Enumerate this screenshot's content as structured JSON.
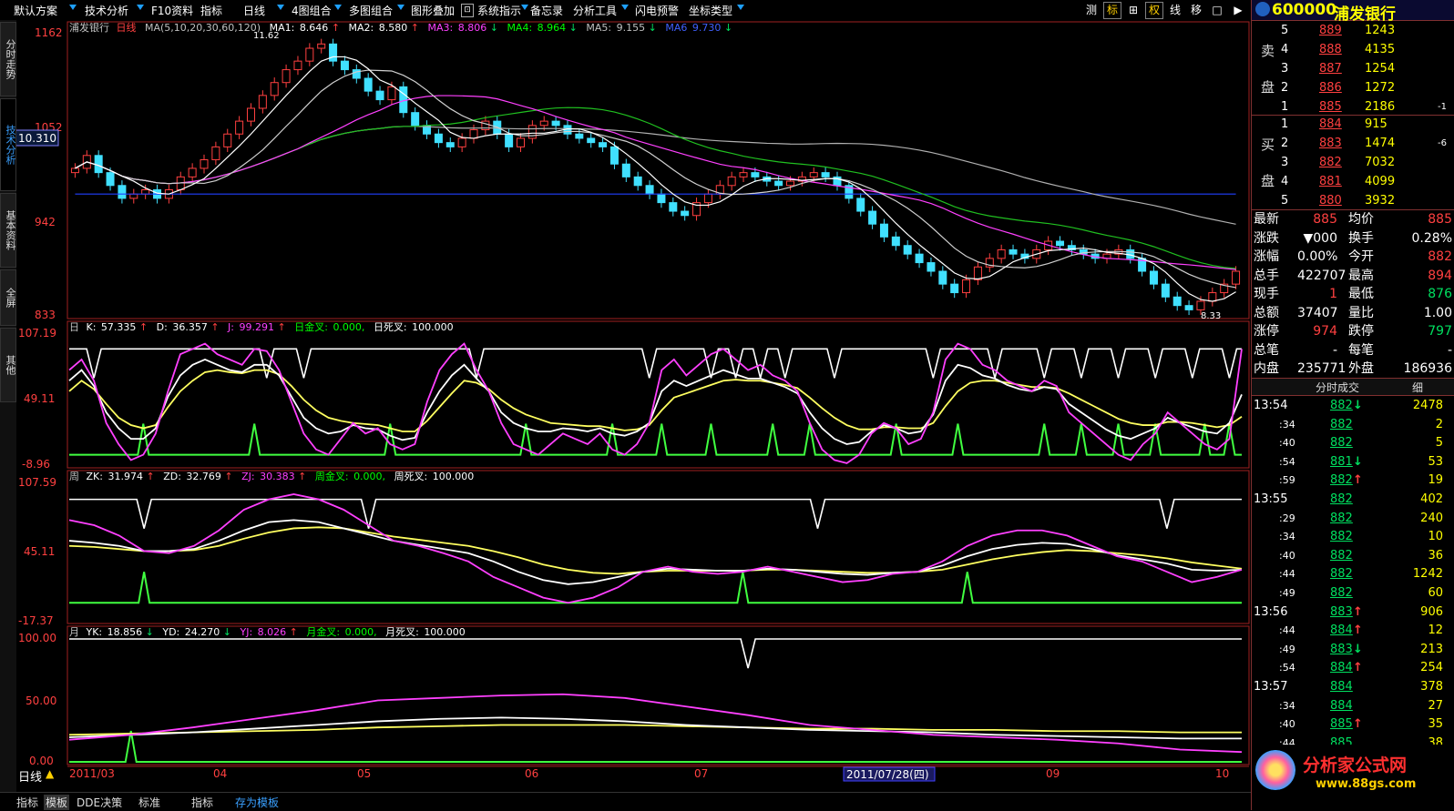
{
  "toolbar": {
    "menus": [
      "默认方案",
      "技术分析",
      "F10资料",
      "指标",
      "日线",
      "4图组合",
      "多图组合",
      "图形叠加",
      "系统指示",
      "备忘录",
      "分析工具",
      "闪电预警",
      "坐标类型"
    ],
    "right_buttons": [
      "测",
      "标",
      "⊞",
      "权",
      "线",
      "移",
      "□",
      "▶"
    ]
  },
  "side_tabs": [
    "分时走势",
    "技术分析",
    "基本资料",
    "全屏",
    "其他"
  ],
  "stock": {
    "code": "600000",
    "name": "浦发银行"
  },
  "main": {
    "title": "浦发银行",
    "period": "日线",
    "ma_header": "MA(5,10,20,30,60,120)",
    "ma": [
      {
        "label": "MA1:",
        "value": "8.646",
        "arrow": "↑",
        "color": "#ffffff"
      },
      {
        "label": "MA2:",
        "value": "8.580",
        "arrow": "↑",
        "color": "#ffffff"
      },
      {
        "label": "MA3:",
        "value": "8.806",
        "arrow": "↓",
        "color": "#ff40ff"
      },
      {
        "label": "MA4:",
        "value": "8.964",
        "arrow": "↓",
        "color": "#00ff00"
      },
      {
        "label": "MA5:",
        "value": "9.155",
        "arrow": "↓",
        "color": "#c0c0c0"
      },
      {
        "label": "MA6",
        "value": "9.730",
        "arrow": "↓",
        "color": "#4060ff"
      }
    ],
    "y_labels": [
      "1162",
      "1052",
      "942",
      "833"
    ],
    "current_price_tag": "10.310",
    "high_label": "11.62",
    "low_label": "8.33",
    "ylim": [
      8.33,
      11.62
    ]
  },
  "kdj": {
    "prefix": "日",
    "items": [
      {
        "label": "K:",
        "value": "57.335",
        "arrow": "↑",
        "color": "#ffffff"
      },
      {
        "label": "D:",
        "value": "36.357",
        "arrow": "↑",
        "color": "#ffffff"
      },
      {
        "label": "J:",
        "value": "99.291",
        "arrow": "↑",
        "color": "#ff40ff"
      },
      {
        "label": "日金叉:",
        "value": "0.000,",
        "arrow": "",
        "color": "#00ff00"
      },
      {
        "label": "日死叉:",
        "value": "100.000",
        "arrow": "",
        "color": "#ffffff"
      }
    ],
    "y_labels": [
      "107.19",
      "49.11",
      "-8.96"
    ]
  },
  "weekly": {
    "prefix": "周",
    "items": [
      {
        "label": "ZK:",
        "value": "31.974",
        "arrow": "↑",
        "color": "#ffffff"
      },
      {
        "label": "ZD:",
        "value": "32.769",
        "arrow": "↑",
        "color": "#ffffff"
      },
      {
        "label": "ZJ:",
        "value": "30.383",
        "arrow": "↑",
        "color": "#ff40ff"
      },
      {
        "label": "周金叉:",
        "value": "0.000,",
        "arrow": "",
        "color": "#00ff00"
      },
      {
        "label": "周死叉:",
        "value": "100.000",
        "arrow": "",
        "color": "#ffffff"
      }
    ],
    "y_labels": [
      "107.59",
      "45.11",
      "-17.37"
    ]
  },
  "monthly": {
    "prefix": "月",
    "items": [
      {
        "label": "YK:",
        "value": "18.856",
        "arrow": "↓",
        "color": "#ffffff"
      },
      {
        "label": "YD:",
        "value": "24.270",
        "arrow": "↓",
        "color": "#ffffff"
      },
      {
        "label": "YJ:",
        "value": "8.026",
        "arrow": "↑",
        "color": "#ff40ff"
      },
      {
        "label": "月金叉:",
        "value": "0.000,",
        "arrow": "",
        "color": "#00ff00"
      },
      {
        "label": "月死叉:",
        "value": "100.000",
        "arrow": "",
        "color": "#ffffff"
      }
    ],
    "y_labels": [
      "100.00",
      "50.00",
      "0.00"
    ]
  },
  "x_axis": {
    "labels": [
      "2011/03",
      "04",
      "05",
      "06",
      "07",
      "09",
      "10"
    ],
    "cursor_date": "2011/07/28(四)"
  },
  "bottom": {
    "period_label": "日线",
    "tabs": [
      "指标",
      "模板",
      "DDE决策",
      "标准",
      "指标",
      "存为模板"
    ]
  },
  "order_book": {
    "sell_label": [
      "卖",
      "盘"
    ],
    "buy_label": [
      "买",
      "盘"
    ],
    "sell": [
      {
        "level": "5",
        "price": "889",
        "vol": "1243",
        "chg": ""
      },
      {
        "level": "4",
        "price": "888",
        "vol": "4135",
        "chg": ""
      },
      {
        "level": "3",
        "price": "887",
        "vol": "1254",
        "chg": ""
      },
      {
        "level": "2",
        "price": "886",
        "vol": "1272",
        "chg": ""
      },
      {
        "level": "1",
        "price": "885",
        "vol": "2186",
        "chg": "-1"
      }
    ],
    "buy": [
      {
        "level": "1",
        "price": "884",
        "vol": "915",
        "chg": ""
      },
      {
        "level": "2",
        "price": "883",
        "vol": "1474",
        "chg": "-6"
      },
      {
        "level": "3",
        "price": "882",
        "vol": "7032",
        "chg": ""
      },
      {
        "level": "4",
        "price": "881",
        "vol": "4099",
        "chg": ""
      },
      {
        "level": "5",
        "price": "880",
        "vol": "3932",
        "chg": ""
      }
    ]
  },
  "stats": [
    {
      "l1": "最新",
      "v1": "885",
      "c1": "red",
      "l2": "均价",
      "v2": "885",
      "c2": "red"
    },
    {
      "l1": "涨跌",
      "v1": "▼000",
      "c1": "white",
      "l2": "换手",
      "v2": "0.28%",
      "c2": "white"
    },
    {
      "l1": "涨幅",
      "v1": "0.00%",
      "c1": "white",
      "l2": "今开",
      "v2": "882",
      "c2": "red"
    },
    {
      "l1": "总手",
      "v1": "422707",
      "c1": "white",
      "l2": "最高",
      "v2": "894",
      "c2": "red"
    },
    {
      "l1": "现手",
      "v1": "1",
      "c1": "red",
      "l2": "最低",
      "v2": "876",
      "c2": "green"
    },
    {
      "l1": "总额",
      "v1": "37407",
      "c1": "white",
      "l2": "量比",
      "v2": "1.00",
      "c2": "white"
    },
    {
      "l1": "涨停",
      "v1": "974",
      "c1": "red",
      "l2": "跌停",
      "v2": "797",
      "c2": "green"
    },
    {
      "l1": "总笔",
      "v1": "-",
      "c1": "white",
      "l2": "每笔",
      "v2": "-",
      "c2": "white"
    },
    {
      "l1": "内盘",
      "v1": "235771",
      "c1": "white",
      "l2": "外盘",
      "v2": "186936",
      "c2": "white"
    }
  ],
  "ticks": {
    "header": "分时成交",
    "detail": "细",
    "rows": [
      {
        "t": "13:54",
        "p": "882",
        "a": "↓",
        "ac": "green",
        "v": "2478"
      },
      {
        "t": ":34",
        "p": "882",
        "a": "",
        "ac": "",
        "v": "2"
      },
      {
        "t": ":40",
        "p": "882",
        "a": "",
        "ac": "",
        "v": "5"
      },
      {
        "t": ":54",
        "p": "881",
        "a": "↓",
        "ac": "green",
        "v": "53"
      },
      {
        "t": ":59",
        "p": "882",
        "a": "↑",
        "ac": "red",
        "v": "19"
      },
      {
        "t": "13:55",
        "p": "882",
        "a": "",
        "ac": "",
        "v": "402"
      },
      {
        "t": ":29",
        "p": "882",
        "a": "",
        "ac": "",
        "v": "240"
      },
      {
        "t": ":34",
        "p": "882",
        "a": "",
        "ac": "",
        "v": "10"
      },
      {
        "t": ":40",
        "p": "882",
        "a": "",
        "ac": "",
        "v": "36"
      },
      {
        "t": ":44",
        "p": "882",
        "a": "",
        "ac": "",
        "v": "1242"
      },
      {
        "t": ":49",
        "p": "882",
        "a": "",
        "ac": "",
        "v": "60"
      },
      {
        "t": "13:56",
        "p": "883",
        "a": "↑",
        "ac": "red",
        "v": "906"
      },
      {
        "t": ":44",
        "p": "884",
        "a": "↑",
        "ac": "red",
        "v": "12"
      },
      {
        "t": ":49",
        "p": "883",
        "a": "↓",
        "ac": "green",
        "v": "213"
      },
      {
        "t": ":54",
        "p": "884",
        "a": "↑",
        "ac": "red",
        "v": "254"
      },
      {
        "t": "13:57",
        "p": "884",
        "a": "",
        "ac": "",
        "v": "378"
      },
      {
        "t": ":34",
        "p": "884",
        "a": "",
        "ac": "",
        "v": "27"
      },
      {
        "t": ":40",
        "p": "885",
        "a": "↑",
        "ac": "red",
        "v": "35"
      },
      {
        "t": ":44",
        "p": "885",
        "a": "",
        "ac": "",
        "v": "38"
      }
    ]
  },
  "watermark": {
    "text": "分析家公式网",
    "url": "www.88gs.com"
  },
  "colors": {
    "up": "#ff4040",
    "down": "#40e0ff",
    "ma_white": "#ffffff",
    "ma_magenta": "#ff40ff",
    "ma_green": "#20c020",
    "ma_gray": "#b0b0b0",
    "ma_blue": "#2040ff",
    "yellow": "#ffff60",
    "gold_cross": "#40ff40"
  },
  "chart_data": {
    "type": "candlestick",
    "ylim": [
      8.33,
      11.62
    ],
    "close_series": [
      10.05,
      10.2,
      10.0,
      9.85,
      9.7,
      9.75,
      9.8,
      9.7,
      9.8,
      9.95,
      10.05,
      10.15,
      10.3,
      10.45,
      10.6,
      10.75,
      10.9,
      11.05,
      11.2,
      11.3,
      11.45,
      11.5,
      11.3,
      11.2,
      11.1,
      10.95,
      10.85,
      11.0,
      10.7,
      10.55,
      10.45,
      10.35,
      10.3,
      10.4,
      10.5,
      10.6,
      10.45,
      10.3,
      10.4,
      10.55,
      10.6,
      10.55,
      10.45,
      10.4,
      10.35,
      10.3,
      10.1,
      9.95,
      9.85,
      9.75,
      9.65,
      9.55,
      9.5,
      9.65,
      9.75,
      9.85,
      9.95,
      10.0,
      9.95,
      9.9,
      9.85,
      9.9,
      9.95,
      10.0,
      9.95,
      9.85,
      9.7,
      9.55,
      9.4,
      9.25,
      9.15,
      9.05,
      8.95,
      8.85,
      8.7,
      8.6,
      8.75,
      8.9,
      9.0,
      9.1,
      9.05,
      9.0,
      9.1,
      9.2,
      9.15,
      9.1,
      9.05,
      9.0,
      9.05,
      9.1,
      9.0,
      8.85,
      8.7,
      8.55,
      8.45,
      8.4,
      8.5,
      8.6,
      8.7,
      8.85
    ],
    "kdj": {
      "J": [
        80,
        90,
        70,
        30,
        10,
        -5,
        0,
        20,
        60,
        95,
        100,
        105,
        95,
        90,
        85,
        100,
        98,
        80,
        50,
        20,
        5,
        0,
        15,
        30,
        20,
        25,
        10,
        5,
        10,
        50,
        80,
        95,
        105,
        80,
        60,
        30,
        10,
        5,
        0,
        10,
        20,
        15,
        10,
        20,
        5,
        0,
        10,
        30,
        80,
        90,
        75,
        85,
        95,
        100,
        90,
        80,
        85,
        75,
        70,
        60,
        30,
        5,
        -5,
        -8,
        0,
        20,
        30,
        25,
        10,
        15,
        40,
        90,
        105,
        100,
        85,
        80,
        70,
        65,
        60,
        70,
        65,
        40,
        30,
        20,
        10,
        0,
        -5,
        10,
        20,
        40,
        30,
        20,
        10,
        5,
        15,
        100
      ],
      "K": [
        70,
        80,
        65,
        40,
        25,
        15,
        15,
        25,
        55,
        75,
        85,
        90,
        85,
        80,
        78,
        85,
        85,
        75,
        55,
        35,
        25,
        20,
        22,
        28,
        25,
        24,
        18,
        14,
        16,
        40,
        60,
        75,
        85,
        72,
        60,
        40,
        30,
        25,
        22,
        22,
        25,
        24,
        22,
        25,
        20,
        18,
        22,
        30,
        60,
        70,
        65,
        70,
        75,
        80,
        76,
        72,
        72,
        68,
        64,
        58,
        40,
        25,
        15,
        10,
        12,
        22,
        28,
        25,
        20,
        22,
        38,
        70,
        85,
        82,
        75,
        72,
        66,
        62,
        60,
        64,
        62,
        48,
        40,
        32,
        24,
        18,
        15,
        20,
        25,
        35,
        30,
        26,
        22,
        20,
        30,
        57
      ],
      "D": [
        60,
        70,
        62,
        48,
        35,
        28,
        25,
        28,
        45,
        60,
        70,
        78,
        80,
        78,
        77,
        80,
        80,
        76,
        65,
        52,
        42,
        35,
        32,
        30,
        29,
        28,
        25,
        22,
        22,
        32,
        45,
        58,
        70,
        68,
        62,
        52,
        44,
        38,
        34,
        30,
        29,
        28,
        27,
        27,
        25,
        23,
        24,
        28,
        42,
        54,
        58,
        62,
        66,
        70,
        71,
        70,
        70,
        68,
        66,
        63,
        54,
        44,
        35,
        28,
        24,
        24,
        26,
        26,
        25,
        25,
        30,
        46,
        60,
        68,
        70,
        70,
        68,
        66,
        64,
        64,
        63,
        58,
        52,
        46,
        40,
        34,
        30,
        28,
        28,
        31,
        31,
        30,
        28,
        26,
        28,
        36
      ]
    },
    "weekly": {
      "ZJ": [
        80,
        75,
        65,
        50,
        48,
        55,
        70,
        90,
        100,
        105,
        100,
        90,
        75,
        60,
        55,
        48,
        40,
        25,
        15,
        5,
        0,
        5,
        15,
        30,
        35,
        30,
        28,
        30,
        35,
        30,
        25,
        20,
        22,
        28,
        30,
        40,
        55,
        65,
        70,
        70,
        65,
        55,
        45,
        40,
        30,
        20,
        25,
        32
      ],
      "ZK": [
        60,
        58,
        55,
        50,
        50,
        52,
        60,
        70,
        78,
        80,
        78,
        72,
        66,
        60,
        56,
        52,
        48,
        40,
        30,
        22,
        18,
        20,
        25,
        30,
        33,
        32,
        31,
        31,
        33,
        32,
        30,
        28,
        27,
        29,
        30,
        36,
        45,
        52,
        56,
        58,
        57,
        52,
        46,
        42,
        38,
        32,
        31,
        32
      ],
      "ZD": [
        55,
        54,
        52,
        50,
        50,
        51,
        55,
        62,
        68,
        72,
        73,
        72,
        68,
        64,
        61,
        58,
        55,
        50,
        44,
        37,
        32,
        29,
        28,
        30,
        31,
        31,
        31,
        31,
        32,
        32,
        31,
        30,
        29,
        29,
        30,
        32,
        37,
        42,
        46,
        49,
        51,
        50,
        48,
        46,
        43,
        39,
        36,
        33
      ]
    },
    "monthly": {
      "YJ": [
        18,
        22,
        28,
        35,
        42,
        50,
        52,
        54,
        55,
        52,
        45,
        38,
        30,
        26,
        22,
        20,
        18,
        15,
        10,
        8
      ],
      "YK": [
        20,
        22,
        24,
        27,
        30,
        33,
        35,
        36,
        35,
        33,
        30,
        28,
        26,
        25,
        24,
        22,
        21,
        20,
        19,
        19
      ],
      "YD": [
        22,
        23,
        24,
        25,
        26,
        28,
        29,
        30,
        30,
        30,
        29,
        28,
        27,
        27,
        26,
        26,
        25,
        25,
        24,
        24
      ]
    }
  }
}
